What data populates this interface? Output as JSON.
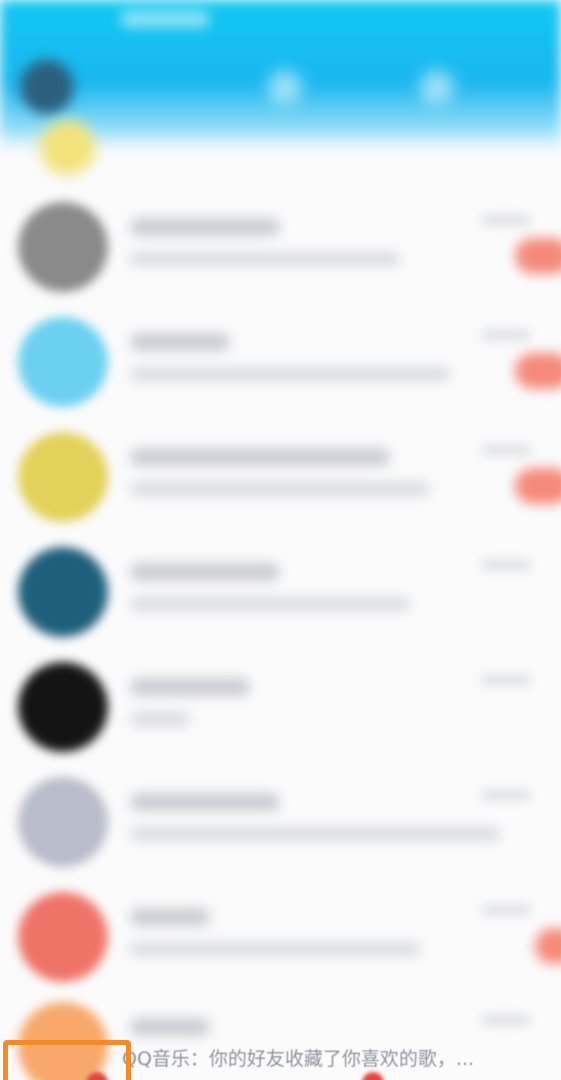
{
  "colors": {
    "header_top": "#10c8f2",
    "header_mid": "#1ab7f0",
    "highlight_border": "#f28c2b",
    "badge": "#f58a7a",
    "notification_dot": "#e2463b"
  },
  "header": {
    "icons": [
      "search-icon",
      "add-icon"
    ]
  },
  "conversations": [
    {
      "avatar_color": "#8a8a8a",
      "badge": true
    },
    {
      "avatar_color": "#6cd0f0",
      "badge": true
    },
    {
      "avatar_color": "#e2d25a",
      "badge": true
    },
    {
      "avatar_color": "#1f5f7c",
      "badge": false
    },
    {
      "avatar_color": "#141414",
      "badge": false
    },
    {
      "avatar_color": "#b8bccb",
      "badge": false
    },
    {
      "avatar_color": "#ef7468",
      "badge": false
    }
  ],
  "last_conversation": {
    "avatar_color": "#f7a86a",
    "preview": "QQ音乐：你的好友收藏了你喜欢的歌，..."
  }
}
